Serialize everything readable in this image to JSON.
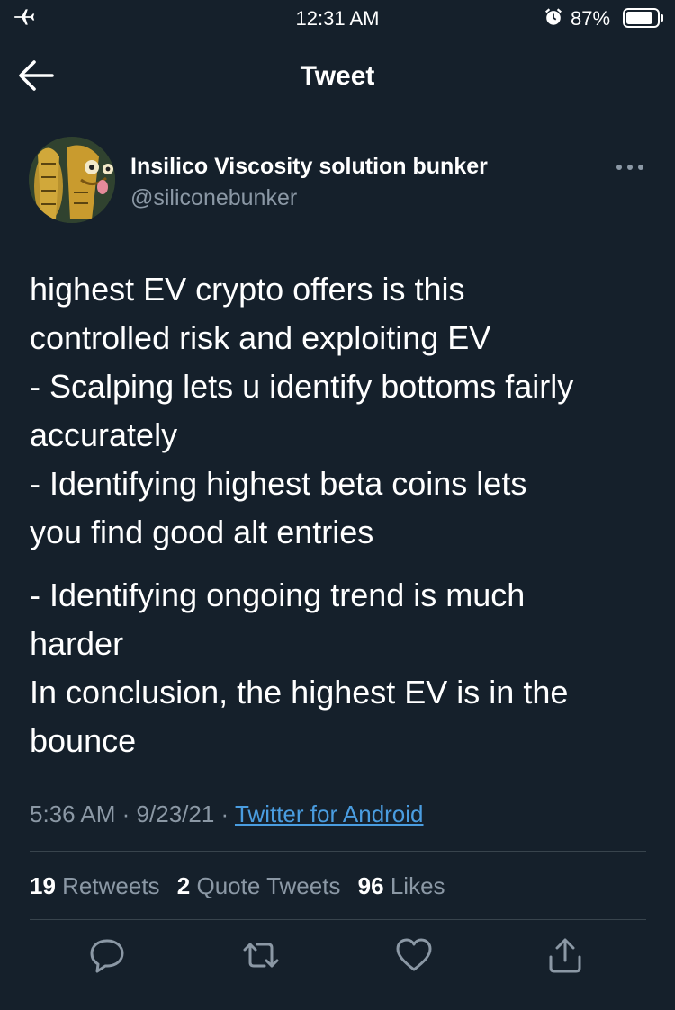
{
  "status_bar": {
    "time": "12:31 AM",
    "battery_percent": "87%",
    "icons": [
      "airplane-icon",
      "alarm-icon",
      "battery-icon"
    ],
    "battery_level": 0.87
  },
  "nav": {
    "title": "Tweet",
    "back_icon": "arrow-left-icon"
  },
  "author": {
    "display_name": "Insilico Viscosity solution bunker",
    "handle": "@siliconebunker",
    "more_icon": "more-dots-icon"
  },
  "tweet": {
    "lines": [
      "highest EV crypto offers is this",
      "controlled risk and exploiting EV",
      "- Scalping lets u identify bottoms fairly",
      "accurately",
      "- Identifying highest beta coins lets",
      "you find good alt entries",
      "- Identifying ongoing trend is much",
      "harder",
      "In conclusion, the highest EV is in the",
      "bounce"
    ],
    "time": "5:36 AM",
    "date": "9/23/21",
    "separator": "·",
    "source": "Twitter for Android"
  },
  "stats": {
    "retweets_count": "19",
    "retweets_label": "Retweets",
    "quotes_count": "2",
    "quotes_label": "Quote Tweets",
    "likes_count": "96",
    "likes_label": "Likes"
  },
  "actions": [
    "reply-icon",
    "retweet-icon",
    "like-icon",
    "share-icon"
  ],
  "colors": {
    "background": "#15202b",
    "text": "#ffffff",
    "secondary": "#8b98a5",
    "link": "#4a9de0",
    "divider": "#38444d"
  }
}
